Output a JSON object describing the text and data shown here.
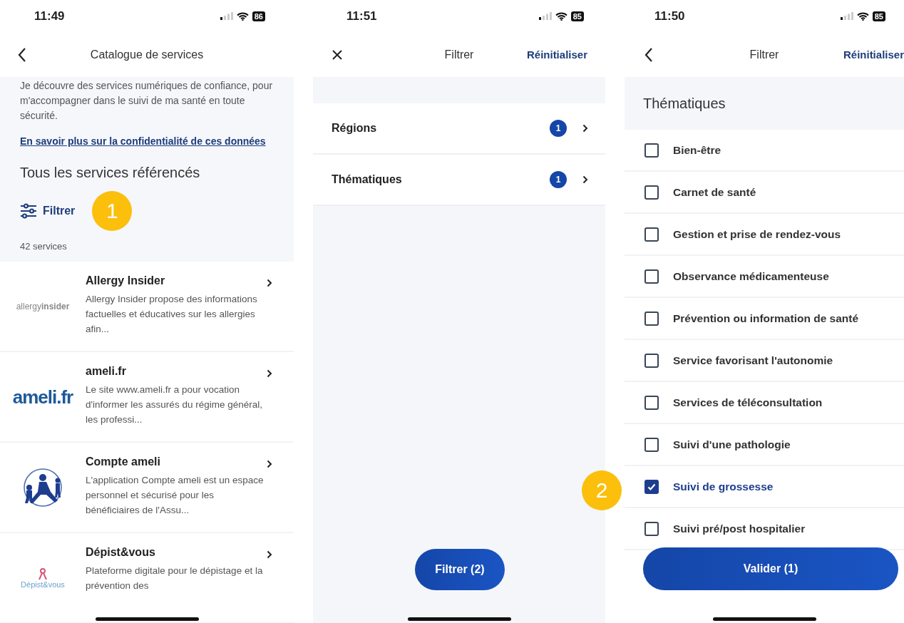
{
  "screens": [
    {
      "kind": "catalog",
      "status": {
        "time": "11:49",
        "battery": "86"
      },
      "nav": {
        "title": "Catalogue de services"
      },
      "intro": "Je découvre des services numériques de confiance, pour m'accompagner dans le suivi de ma santé en toute sécurité.",
      "link": "En savoir plus sur la confidentialité de ces données",
      "heading": "Tous les services référencés",
      "filter_button": "Filtrer",
      "callout": "1",
      "count": "42 services",
      "services": [
        {
          "kind": "allergy",
          "logo": "allergy**insider**",
          "name": "Allergy Insider",
          "description": "Allergy Insider propose des informations factuelles et éducatives sur les allergies afin..."
        },
        {
          "kind": "ameli",
          "logo": "ameli.fr",
          "name": "ameli.fr",
          "description": "Le site www.ameli.fr a pour vocation d'informer les assurés du régime général, les professi..."
        },
        {
          "kind": "emblem",
          "name": "Compte ameli",
          "description": "L'application Compte ameli est un espace personnel et sécurisé pour les bénéficiaires de l'Assu..."
        },
        {
          "kind": "ribbon",
          "logo": "Dépist&vous",
          "name": "Dépist&vous",
          "description": "Plateforme digitale pour le dépistage et la prévention des"
        }
      ]
    },
    {
      "kind": "filter_menu",
      "status": {
        "time": "11:51",
        "battery": "85"
      },
      "nav": {
        "title": "Filtrer",
        "reset": "Réinitialiser"
      },
      "rows": [
        {
          "label": "Régions",
          "count": "1"
        },
        {
          "label": "Thématiques",
          "count": "1"
        }
      ],
      "apply_button": "Filtrer (2)"
    },
    {
      "kind": "checklist",
      "status": {
        "time": "11:50",
        "battery": "85"
      },
      "nav": {
        "title": "Filtrer",
        "reset": "Réinitialiser"
      },
      "heading": "Thématiques",
      "callout": "2",
      "options": [
        {
          "label": "Bien-être",
          "checked": false
        },
        {
          "label": "Carnet de santé",
          "checked": false
        },
        {
          "label": "Gestion et prise de rendez-vous",
          "checked": false
        },
        {
          "label": "Observance médicamenteuse",
          "checked": false
        },
        {
          "label": "Prévention ou information de santé",
          "checked": false
        },
        {
          "label": "Service favorisant l'autonomie",
          "checked": false
        },
        {
          "label": "Services de téléconsultation",
          "checked": false
        },
        {
          "label": "Suivi d'une pathologie",
          "checked": false
        },
        {
          "label": "Suivi de grossesse",
          "checked": true
        },
        {
          "label": "Suivi pré/post hospitalier",
          "checked": false
        }
      ],
      "apply_button": "Valider (1)"
    }
  ]
}
